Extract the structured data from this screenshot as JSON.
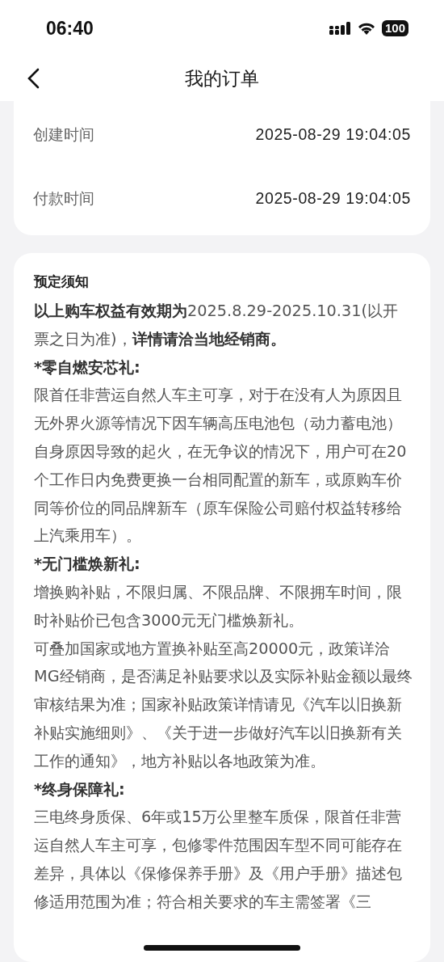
{
  "status_bar": {
    "time": "06:40",
    "battery": "100"
  },
  "nav": {
    "title": "我的订单"
  },
  "order_info": [
    {
      "label": "创建时间",
      "value": "2025-08-29 19:04:05"
    },
    {
      "label": "付款时间",
      "value": "2025-08-29 19:04:05"
    }
  ],
  "notice": {
    "title": "预定须知",
    "items": [
      {
        "kind": "text",
        "text": "**以上购车权益有效期为**2025.8.29-2025.10.31(以开票之日为准)，**详情请洽当地经销商。**"
      },
      {
        "kind": "heading",
        "text": "*零自燃安芯礼:"
      },
      {
        "kind": "text",
        "text": "限首任非营运自然人车主可享，对于在没有人为原因且无外界火源等情况下因车辆高压电池包（动力蓄电池）自身原因导致的起火，在无争议的情况下，用户可在20个工作日内免费更换一台相同配置的新车，或原购车价同等价位的同品牌新车（原车保险公司赔付权益转移给上汽乘用车）。"
      },
      {
        "kind": "heading",
        "text": "*无门槛焕新礼:"
      },
      {
        "kind": "text",
        "text": "增换购补贴，不限归属、不限品牌、不限拥车时间，限时补贴价已包含3000元无门槛焕新礼。"
      },
      {
        "kind": "text",
        "text": "可叠加国家或地方置换补贴至高20000元，政策详洽MG经销商，是否满足补贴要求以及实际补贴金额以最终审核结果为准；国家补贴政策详情请见《汽车以旧换新补贴实施细则》、《关于进一步做好汽车以旧换新有关工作的通知》，地方补贴以各地政策为准。"
      },
      {
        "kind": "heading",
        "text": "*终身保障礼:"
      },
      {
        "kind": "text",
        "text": "三电终身质保、6年或15万公里整车质保，限首任非营运自然人车主可享，包修零件范围因车型不同可能存在差异，具体以《保修保养手册》及《用户手册》描述包修适用范围为准；符合相关要求的车主需签署《三"
      }
    ]
  }
}
